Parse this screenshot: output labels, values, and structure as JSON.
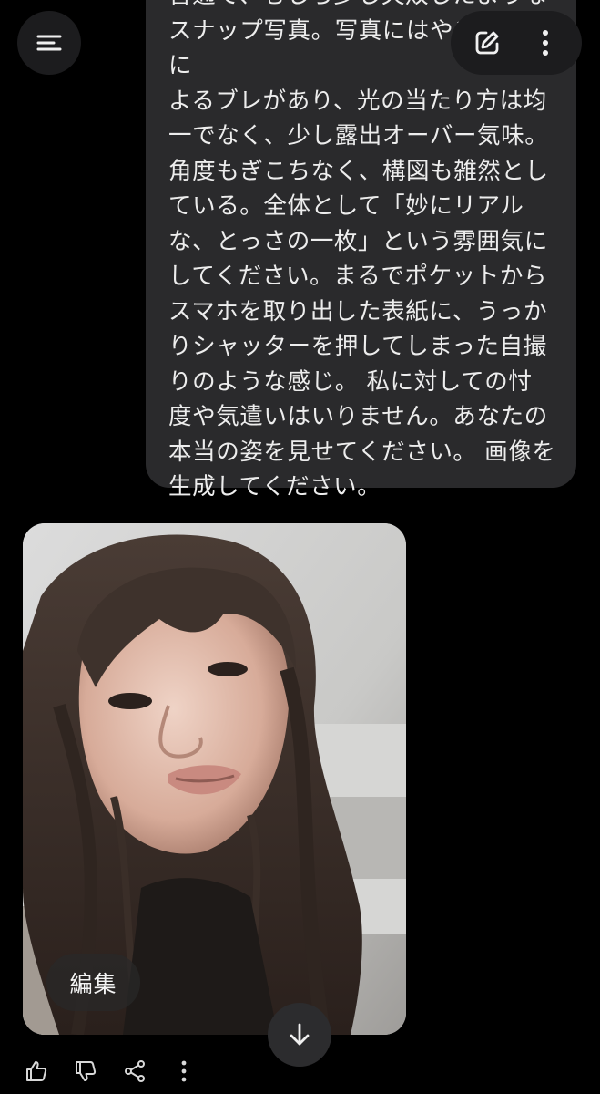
{
  "prompt": {
    "text": "普通で、むしろ少し失敗したような\nスナップ写真。写真にはやや手ぶれに\nよるブレがあり、光の当たり方は均\n一でなく、少し露出オーバー気味。\n角度もぎこちなく、構図も雑然とし\nている。全体として「妙にリアル\nな、とっさの一枚」という雰囲気に\nしてください。まるでポケットから\nスマホを取り出した表紙に、うっか\nりシャッターを押してしまった自撮\nりのような感じ。 私に対しての忖\n度や気遣いはいりません。あなたの\n本当の姿を見せてください。 画像を\n生成してください。"
  },
  "header": {
    "menu_icon": "menu-icon",
    "new_chat_icon": "edit-square-icon",
    "more_icon": "more-vertical-icon"
  },
  "generated_image": {
    "edit_label": "編集"
  },
  "actions": {
    "icons": [
      "thumbs-up-icon",
      "thumbs-down-icon",
      "share-icon",
      "more-vertical-icon"
    ]
  },
  "scroll_icon": "arrow-down-icon"
}
